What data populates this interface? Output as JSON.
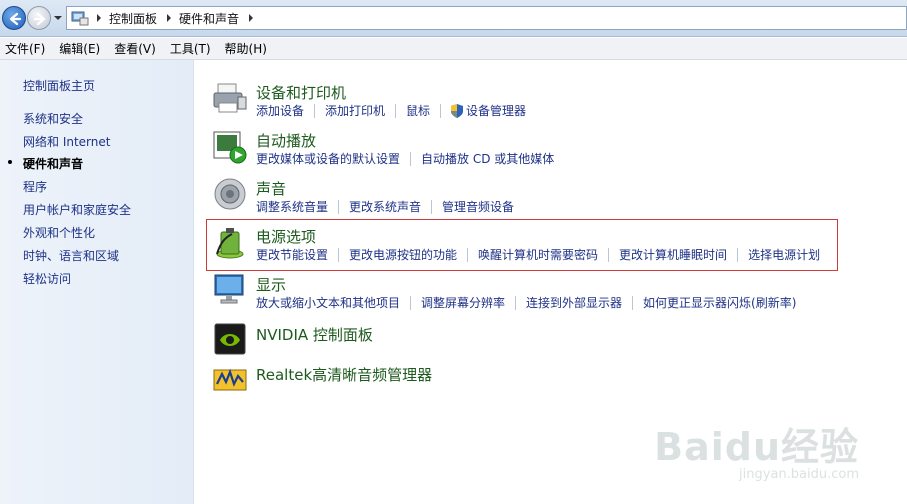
{
  "address": {
    "crumbs": [
      "控制面板",
      "硬件和声音"
    ]
  },
  "menu": [
    "文件(F)",
    "编辑(E)",
    "查看(V)",
    "工具(T)",
    "帮助(H)"
  ],
  "sidebar": {
    "items": [
      {
        "label": "控制面板主页",
        "active": false
      },
      {
        "label": "系统和安全",
        "active": false
      },
      {
        "label": "网络和 Internet",
        "active": false
      },
      {
        "label": "硬件和声音",
        "active": true
      },
      {
        "label": "程序",
        "active": false
      },
      {
        "label": "用户帐户和家庭安全",
        "active": false
      },
      {
        "label": "外观和个性化",
        "active": false
      },
      {
        "label": "时钟、语言和区域",
        "active": false
      },
      {
        "label": "轻松访问",
        "active": false
      }
    ]
  },
  "categories": [
    {
      "title": "设备和打印机",
      "icon": "printer-icon",
      "links": [
        "添加设备",
        "添加打印机",
        "鼠标",
        "设备管理器"
      ]
    },
    {
      "title": "自动播放",
      "icon": "autoplay-icon",
      "links": [
        "更改媒体或设备的默认设置",
        "自动播放 CD 或其他媒体"
      ]
    },
    {
      "title": "声音",
      "icon": "speaker-icon",
      "links": [
        "调整系统音量",
        "更改系统声音",
        "管理音频设备"
      ]
    },
    {
      "title": "电源选项",
      "icon": "battery-icon",
      "links": [
        "更改节能设置",
        "更改电源按钮的功能",
        "唤醒计算机时需要密码",
        "更改计算机睡眠时间",
        "选择电源计划"
      ]
    },
    {
      "title": "显示",
      "icon": "monitor-icon",
      "links": [
        "放大或缩小文本和其他项目",
        "调整屏幕分辨率",
        "连接到外部显示器",
        "如何更正显示器闪烁(刷新率)"
      ]
    },
    {
      "title": "NVIDIA 控制面板",
      "icon": "nvidia-icon",
      "links": []
    },
    {
      "title": "Realtek高清晰音频管理器",
      "icon": "realtek-icon",
      "links": []
    }
  ],
  "watermark": {
    "logo": "Baidu经验",
    "url": "jingyan.baidu.com"
  }
}
